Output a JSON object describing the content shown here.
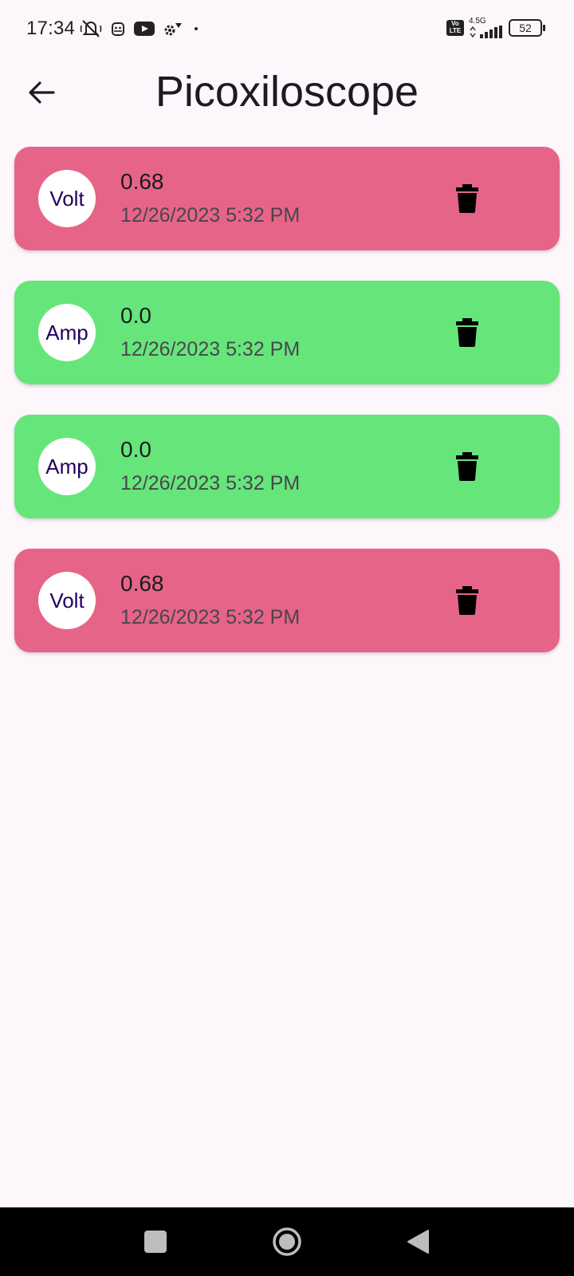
{
  "status_bar": {
    "time": "17:34",
    "network_label": "4.5G",
    "volte_label": "Vo LTE",
    "battery": "52"
  },
  "app_bar": {
    "title": "Picoxiloscope",
    "back_icon": "arrow-back-icon"
  },
  "readings": [
    {
      "type": "Volt",
      "value": "0.68",
      "timestamp": "12/26/2023 5:32 PM",
      "color": "#E66488"
    },
    {
      "type": "Amp",
      "value": "0.0",
      "timestamp": "12/26/2023 5:32 PM",
      "color": "#66E67A"
    },
    {
      "type": "Amp",
      "value": "0.0",
      "timestamp": "12/26/2023 5:32 PM",
      "color": "#66E67A"
    },
    {
      "type": "Volt",
      "value": "0.68",
      "timestamp": "12/26/2023 5:32 PM",
      "color": "#E66488"
    }
  ],
  "colors": {
    "background": "#FDF7FC",
    "volt_card": "#E66488",
    "amp_card": "#66E67A",
    "avatar_text": "#21005D"
  },
  "nav_bar": {
    "recents_icon": "square-icon",
    "home_icon": "circle-icon",
    "back_icon": "triangle-back-icon"
  }
}
